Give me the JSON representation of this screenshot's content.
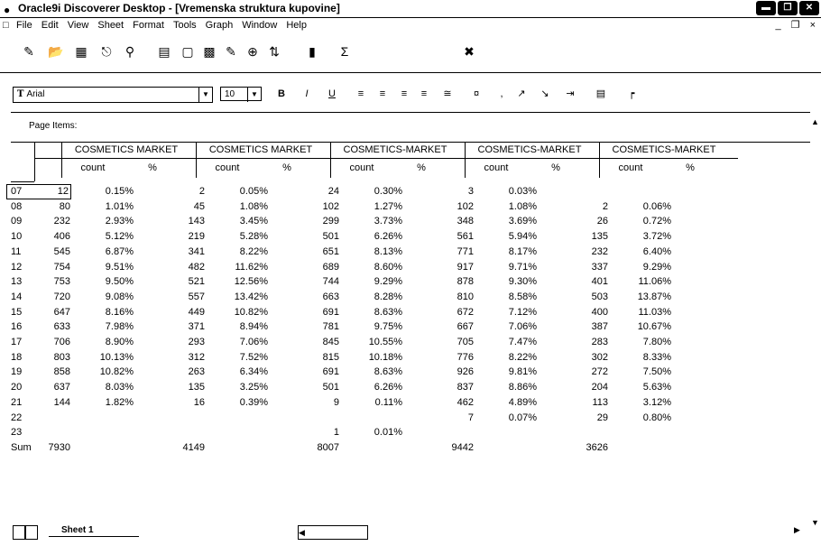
{
  "window": {
    "title": "Oracle9i Discoverer Desktop - [Vremenska struktura kupovine]",
    "controls": [
      "minimize",
      "restore",
      "close"
    ]
  },
  "menu": {
    "items": [
      "File",
      "Edit",
      "View",
      "Sheet",
      "Format",
      "Tools",
      "Graph",
      "Window",
      "Help"
    ]
  },
  "toolbar": {
    "font_name": "Arial",
    "font_size": "10",
    "bold_label": "B",
    "italic_label": "I",
    "underline_label": "U"
  },
  "page_items": {
    "label": "Page Items:"
  },
  "grid": {
    "column_groups": [
      "COSMETICS MARKET",
      "COSMETICS MARKET",
      "COSMETICS-MARKET",
      "COSMETICS-MARKET",
      "COSMETICS-MARKET"
    ],
    "sub_headers": [
      "count",
      "%"
    ],
    "rows": [
      {
        "label": "07",
        "values": [
          "12",
          "0.15%",
          "2",
          "0.05%",
          "24",
          "0.30%",
          "3",
          "0.03%",
          "",
          ""
        ]
      },
      {
        "label": "08",
        "values": [
          "80",
          "1.01%",
          "45",
          "1.08%",
          "102",
          "1.27%",
          "102",
          "1.08%",
          "2",
          "0.06%"
        ]
      },
      {
        "label": "09",
        "values": [
          "232",
          "2.93%",
          "143",
          "3.45%",
          "299",
          "3.73%",
          "348",
          "3.69%",
          "26",
          "0.72%"
        ]
      },
      {
        "label": "10",
        "values": [
          "406",
          "5.12%",
          "219",
          "5.28%",
          "501",
          "6.26%",
          "561",
          "5.94%",
          "135",
          "3.72%"
        ]
      },
      {
        "label": "11",
        "values": [
          "545",
          "6.87%",
          "341",
          "8.22%",
          "651",
          "8.13%",
          "771",
          "8.17%",
          "232",
          "6.40%"
        ]
      },
      {
        "label": "12",
        "values": [
          "754",
          "9.51%",
          "482",
          "11.62%",
          "689",
          "8.60%",
          "917",
          "9.71%",
          "337",
          "9.29%"
        ]
      },
      {
        "label": "13",
        "values": [
          "753",
          "9.50%",
          "521",
          "12.56%",
          "744",
          "9.29%",
          "878",
          "9.30%",
          "401",
          "11.06%"
        ]
      },
      {
        "label": "14",
        "values": [
          "720",
          "9.08%",
          "557",
          "13.42%",
          "663",
          "8.28%",
          "810",
          "8.58%",
          "503",
          "13.87%"
        ]
      },
      {
        "label": "15",
        "values": [
          "647",
          "8.16%",
          "449",
          "10.82%",
          "691",
          "8.63%",
          "672",
          "7.12%",
          "400",
          "11.03%"
        ]
      },
      {
        "label": "16",
        "values": [
          "633",
          "7.98%",
          "371",
          "8.94%",
          "781",
          "9.75%",
          "667",
          "7.06%",
          "387",
          "10.67%"
        ]
      },
      {
        "label": "17",
        "values": [
          "706",
          "8.90%",
          "293",
          "7.06%",
          "845",
          "10.55%",
          "705",
          "7.47%",
          "283",
          "7.80%"
        ]
      },
      {
        "label": "18",
        "values": [
          "803",
          "10.13%",
          "312",
          "7.52%",
          "815",
          "10.18%",
          "776",
          "8.22%",
          "302",
          "8.33%"
        ]
      },
      {
        "label": "19",
        "values": [
          "858",
          "10.82%",
          "263",
          "6.34%",
          "691",
          "8.63%",
          "926",
          "9.81%",
          "272",
          "7.50%"
        ]
      },
      {
        "label": "20",
        "values": [
          "637",
          "8.03%",
          "135",
          "3.25%",
          "501",
          "6.26%",
          "837",
          "8.86%",
          "204",
          "5.63%"
        ]
      },
      {
        "label": "21",
        "values": [
          "144",
          "1.82%",
          "16",
          "0.39%",
          "9",
          "0.11%",
          "462",
          "4.89%",
          "113",
          "3.12%"
        ]
      },
      {
        "label": "22",
        "values": [
          "",
          "",
          "",
          "",
          "",
          "",
          "7",
          "0.07%",
          "29",
          "0.80%"
        ]
      },
      {
        "label": "23",
        "values": [
          "",
          "",
          "",
          "",
          "1",
          "0.01%",
          "",
          "",
          "",
          ""
        ]
      },
      {
        "label": "Sum",
        "values": [
          "7930",
          "",
          "4149",
          "",
          "8007",
          "",
          "9442",
          "",
          "3626",
          ""
        ]
      }
    ]
  },
  "sheet_tabs": {
    "active": "Sheet 1"
  }
}
